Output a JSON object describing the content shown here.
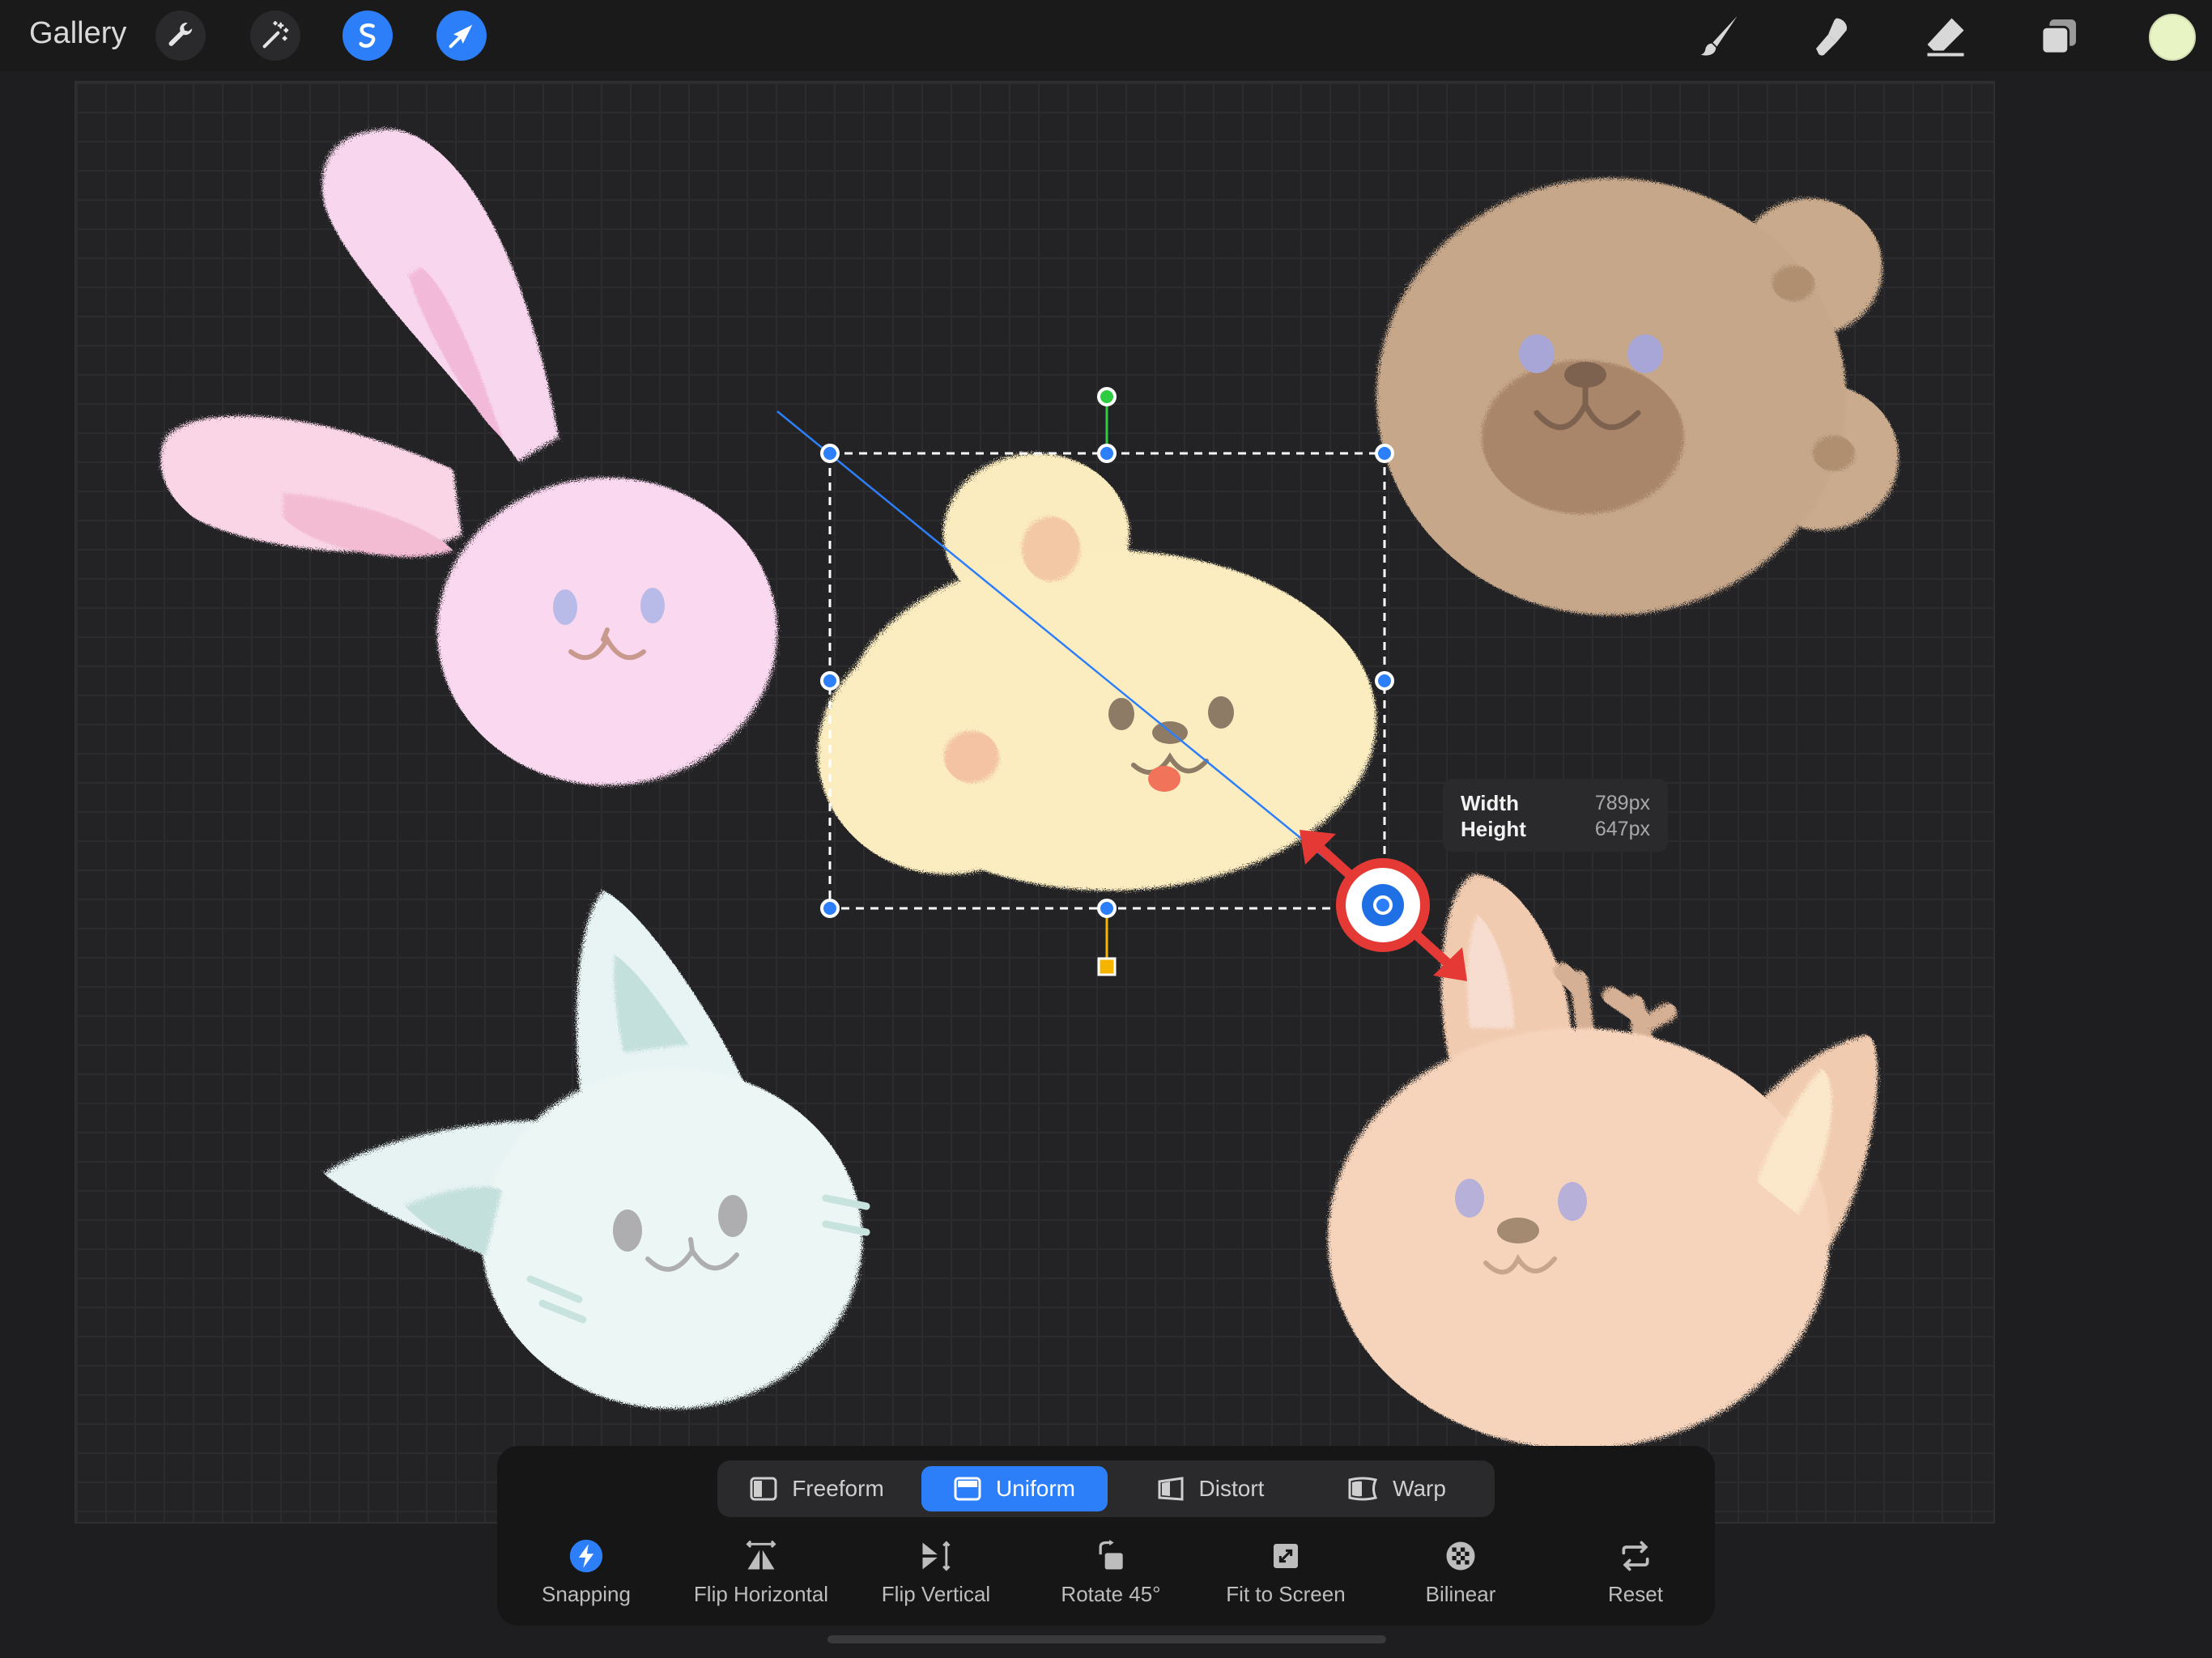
{
  "topbar": {
    "gallery_label": "Gallery",
    "left_tools": [
      {
        "icon": "wrench-icon",
        "active": false
      },
      {
        "icon": "magic-wand-icon",
        "active": false
      },
      {
        "icon": "selection-icon",
        "active": true
      },
      {
        "icon": "transform-arrow-icon",
        "active": true
      }
    ],
    "right_tools": [
      "brush-icon",
      "smudge-icon",
      "eraser-icon",
      "layers-icon"
    ],
    "current_color": "#e8f4c4"
  },
  "size_readout": {
    "width_label": "Width",
    "width_value": "789px",
    "height_label": "Height",
    "height_value": "647px"
  },
  "transform_modes": [
    {
      "label": "Freeform",
      "active": false
    },
    {
      "label": "Uniform",
      "active": true
    },
    {
      "label": "Distort",
      "active": false
    },
    {
      "label": "Warp",
      "active": false
    }
  ],
  "actions": [
    {
      "label": "Snapping",
      "icon": "lightning-icon",
      "active": true
    },
    {
      "label": "Flip Horizontal",
      "icon": "flip-horizontal-icon",
      "active": false
    },
    {
      "label": "Flip Vertical",
      "icon": "flip-vertical-icon",
      "active": false
    },
    {
      "label": "Rotate 45°",
      "icon": "rotate-icon",
      "active": false
    },
    {
      "label": "Fit to Screen",
      "icon": "fit-to-screen-icon",
      "active": false
    },
    {
      "label": "Bilinear",
      "icon": "bilinear-icon",
      "active": false
    },
    {
      "label": "Reset",
      "icon": "reset-icon",
      "active": false
    }
  ],
  "colors": {
    "accent": "#2d7ff9",
    "drag_indicator": "#e53935",
    "rotate_handle": "#2ecc40",
    "pivot_handle": "#f5b400",
    "bunny": "#f8d6ee",
    "dog": "#fbecbf",
    "bear": "#c8a98b",
    "cat": "#e9f5f4",
    "deer": "#f3d0b5"
  }
}
